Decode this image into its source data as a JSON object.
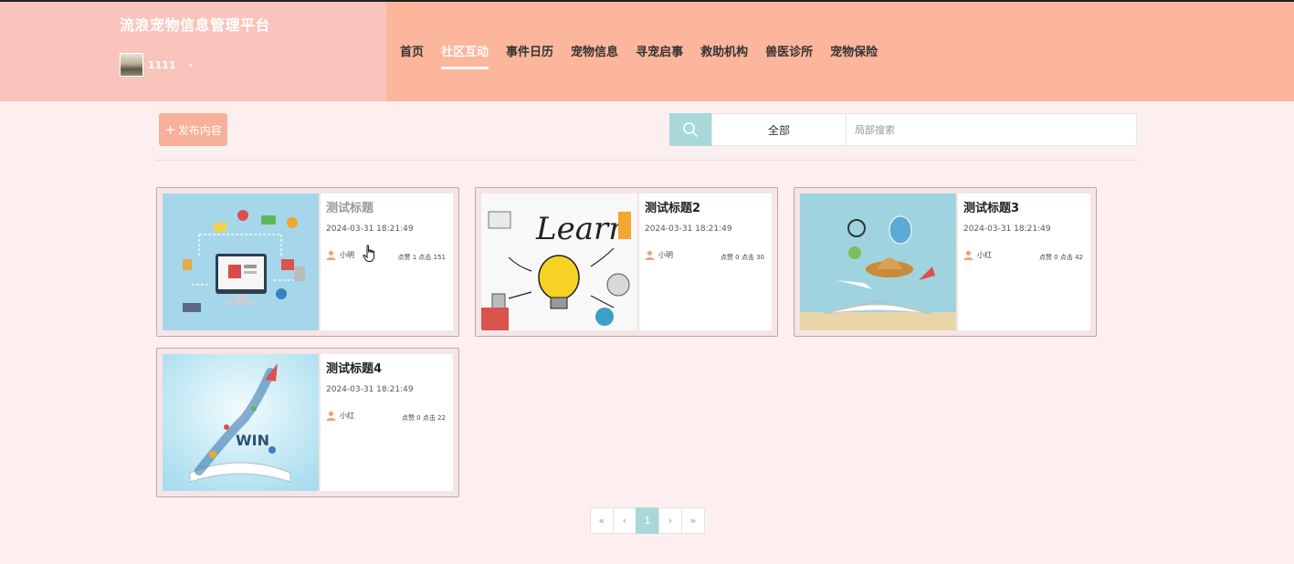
{
  "site": {
    "title": "流浪宠物信息管理平台"
  },
  "user": {
    "name": "1111",
    "caret": "▾"
  },
  "nav": {
    "items": [
      {
        "label": "首页"
      },
      {
        "label": "社区互动"
      },
      {
        "label": "事件日历"
      },
      {
        "label": "宠物信息"
      },
      {
        "label": "寻宠启事"
      },
      {
        "label": "救助机构"
      },
      {
        "label": "兽医诊所"
      },
      {
        "label": "宠物保险"
      }
    ],
    "active_index": 1
  },
  "toolbar": {
    "publish_label": "发布内容",
    "publish_plus": "+",
    "filter_selected": "全部",
    "search_placeholder": "局部搜索"
  },
  "posts": [
    {
      "title": "测试标题",
      "date": "2024-03-31 18:21:49",
      "author": "小明",
      "stats": "点赞 1 点击 151"
    },
    {
      "title": "测试标题2",
      "date": "2024-03-31 18:21:49",
      "author": "小明",
      "stats": "点赞 0 点击 30"
    },
    {
      "title": "测试标题3",
      "date": "2024-03-31 18:21:49",
      "author": "小红",
      "stats": "点赞 0 点击 42"
    },
    {
      "title": "测试标题4",
      "date": "2024-03-31 18:21:49",
      "author": "小红",
      "stats": "点赞 0 点击 22"
    }
  ],
  "pagination": {
    "first": "«",
    "prev": "‹",
    "current": "1",
    "next": "›",
    "last": "»"
  },
  "colors": {
    "header": "#fcb69b",
    "header_left": "#f9c4bb",
    "accent": "#a9d8d9",
    "publish": "#f7b09a",
    "background": "#fdefef"
  }
}
